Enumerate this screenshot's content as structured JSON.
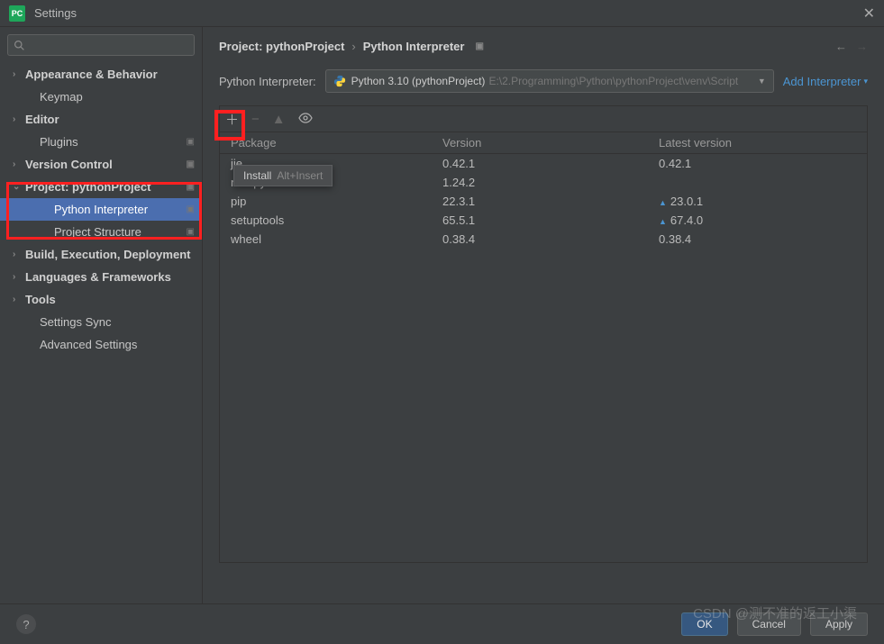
{
  "window": {
    "title": "Settings",
    "app_icon": "PC"
  },
  "search": {
    "placeholder": ""
  },
  "sidebar": {
    "items": [
      {
        "label": "Appearance & Behavior",
        "expandable": true,
        "bold": true
      },
      {
        "label": "Keymap",
        "expandable": false,
        "child": true
      },
      {
        "label": "Editor",
        "expandable": true,
        "bold": true
      },
      {
        "label": "Plugins",
        "expandable": false,
        "child": true,
        "badge": true
      },
      {
        "label": "Version Control",
        "expandable": true,
        "bold": true,
        "badge": true
      },
      {
        "label": "Project: pythonProject",
        "expandable": true,
        "bold": true,
        "expanded": true,
        "badge": true
      },
      {
        "label": "Python Interpreter",
        "expandable": false,
        "grandchild": true,
        "selected": true,
        "badge": true
      },
      {
        "label": "Project Structure",
        "expandable": false,
        "grandchild": true,
        "badge": true
      },
      {
        "label": "Build, Execution, Deployment",
        "expandable": true,
        "bold": true
      },
      {
        "label": "Languages & Frameworks",
        "expandable": true,
        "bold": true
      },
      {
        "label": "Tools",
        "expandable": true,
        "bold": true
      },
      {
        "label": "Settings Sync",
        "expandable": false,
        "child": true
      },
      {
        "label": "Advanced Settings",
        "expandable": false,
        "child": true
      }
    ]
  },
  "breadcrumb": {
    "project": "Project: pythonProject",
    "page": "Python Interpreter"
  },
  "interpreter": {
    "label": "Python Interpreter:",
    "name": "Python 3.10 (pythonProject)",
    "path": "E:\\2.Programming\\Python\\pythonProject\\venv\\Script",
    "add_link": "Add Interpreter"
  },
  "tooltip": {
    "label": "Install",
    "shortcut": "Alt+Insert"
  },
  "table": {
    "headers": {
      "package": "Package",
      "version": "Version",
      "latest": "Latest version"
    },
    "rows": [
      {
        "package": "jie",
        "version": "0.42.1",
        "latest": "0.42.1",
        "upgrade": false
      },
      {
        "package": "numpy",
        "version": "1.24.2",
        "latest": "",
        "upgrade": false
      },
      {
        "package": "pip",
        "version": "22.3.1",
        "latest": "23.0.1",
        "upgrade": true
      },
      {
        "package": "setuptools",
        "version": "65.5.1",
        "latest": "67.4.0",
        "upgrade": true
      },
      {
        "package": "wheel",
        "version": "0.38.4",
        "latest": "0.38.4",
        "upgrade": false
      }
    ]
  },
  "footer": {
    "ok": "OK",
    "cancel": "Cancel",
    "apply": "Apply"
  },
  "watermark": "CSDN @测不准的返工小渠"
}
